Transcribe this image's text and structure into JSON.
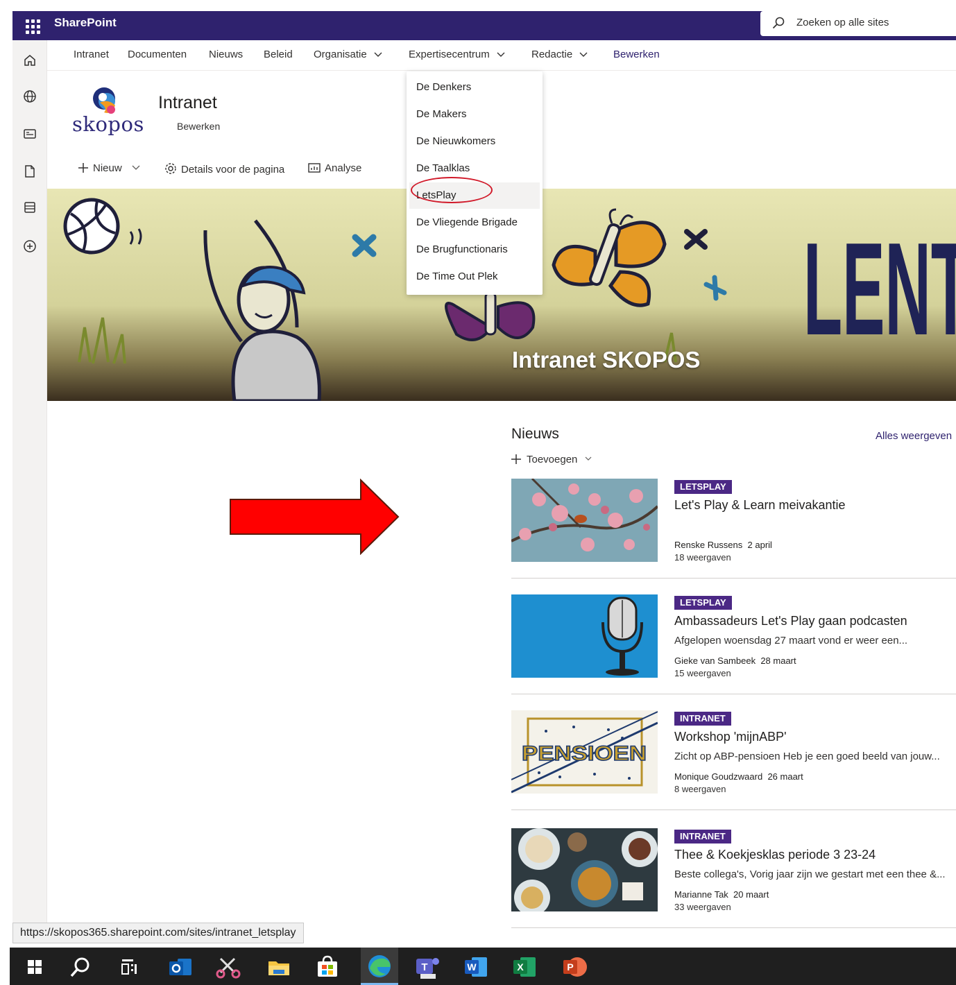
{
  "suitebar": {
    "app_name": "SharePoint",
    "search_placeholder": "Zoeken op alle sites"
  },
  "hubnav": {
    "items": [
      {
        "label": "Intranet"
      },
      {
        "label": "Documenten"
      },
      {
        "label": "Nieuws"
      },
      {
        "label": "Beleid"
      },
      {
        "label": "Organisatie"
      },
      {
        "label": "Expertisecentrum"
      },
      {
        "label": "Redactie"
      }
    ],
    "edit_label": "Bewerken"
  },
  "dropdown": {
    "items": [
      {
        "label": "De Denkers"
      },
      {
        "label": "De Makers"
      },
      {
        "label": "De Nieuwkomers"
      },
      {
        "label": "De Taalklas"
      },
      {
        "label": "LetsPlay"
      },
      {
        "label": "De Vliegende Brigade"
      },
      {
        "label": "De Brugfunctionaris"
      },
      {
        "label": "De Time Out Plek"
      }
    ],
    "highlighted": "LetsPlay"
  },
  "site": {
    "logo_text": "skopos",
    "title": "Intranet",
    "edit_label": "Bewerken"
  },
  "commandbar": {
    "new_label": "Nieuw",
    "details_label": "Details voor de pagina",
    "analytics_label": "Analyse"
  },
  "hero": {
    "title": "Intranet SKOPOS",
    "banner_text": "LENT"
  },
  "news": {
    "title": "Nieuws",
    "see_all": "Alles weergeven",
    "add_label": "Toevoegen",
    "items": [
      {
        "tag": "LETSPLAY",
        "title": "Let's Play & Learn meivakantie",
        "description": "",
        "author": "Renske Russens",
        "date": "2 april",
        "views": "18 weergaven"
      },
      {
        "tag": "LETSPLAY",
        "title": "Ambassadeurs Let's Play gaan podcasten",
        "description": "Afgelopen woensdag 27 maart vond er weer een...",
        "author": "Gieke van Sambeek",
        "date": "28 maart",
        "views": "15 weergaven"
      },
      {
        "tag": "INTRANET",
        "title": "Workshop 'mijnABP'",
        "description": "Zicht op ABP-pensioen Heb je een goed beeld van jouw...",
        "author": "Monique Goudzwaard",
        "date": "26 maart",
        "views": "8 weergaven",
        "thumb_text": "PENSIOEN"
      },
      {
        "tag": "INTRANET",
        "title": "Thee & Koekjesklas periode 3 23-24",
        "description": "Beste collega's, Vorig jaar zijn we gestart met een thee &...",
        "author": "Marianne Tak",
        "date": "20 maart",
        "views": "33 weergaven"
      }
    ]
  },
  "status_url": "https://skopos365.sharepoint.com/sites/intranet_letsplay",
  "colors": {
    "suitebar": "#2f226e",
    "accent": "#4b2885",
    "annotation_red": "#ff0000"
  }
}
